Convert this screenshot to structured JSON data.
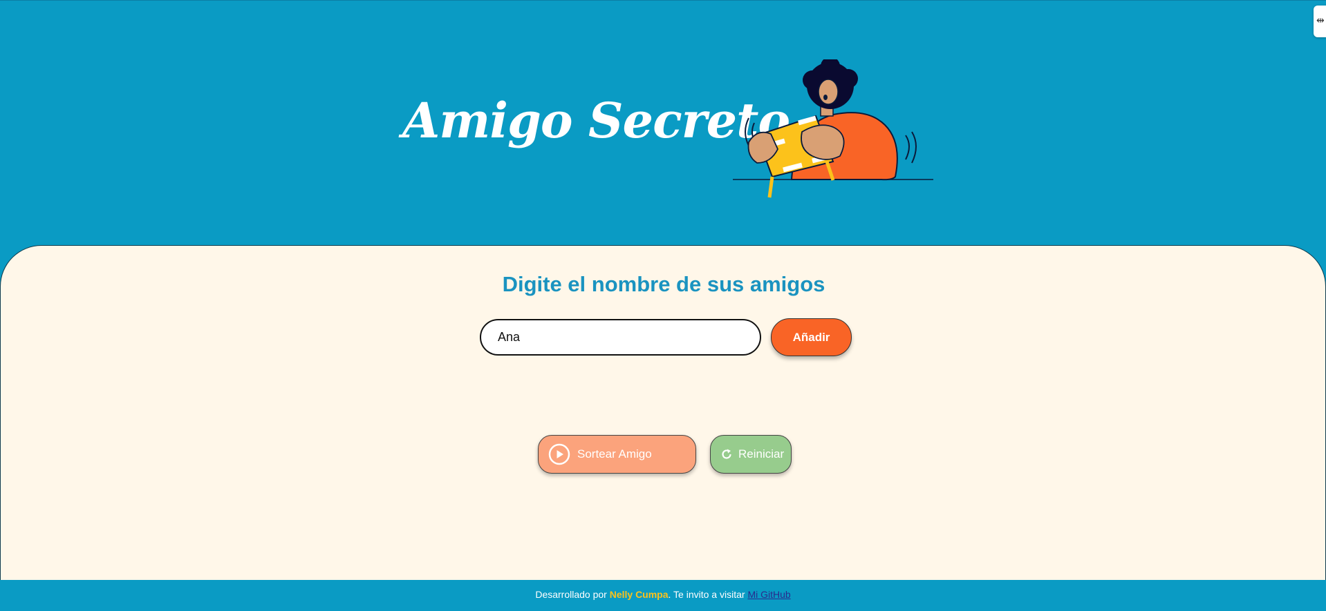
{
  "header": {
    "title": "Amigo Secreto"
  },
  "main": {
    "subtitle": "Digite el nombre de sus amigos",
    "input": {
      "value": "Ana",
      "placeholder": ""
    },
    "add_button": "Añadir",
    "draw_button": "Sortear Amigo",
    "reset_button": "Reiniciar"
  },
  "footer": {
    "prefix": "Desarrollado por ",
    "author": "Nelly Cumpa",
    "middle": ". Te invito a visitar ",
    "link": "Mi GitHub"
  },
  "colors": {
    "background": "#0a9bc4",
    "panel": "#fff7e9",
    "accent": "#f96426",
    "draw_button": "#fba37c",
    "reset_button": "#97cc8d",
    "author": "#fcc21b"
  },
  "icons": {
    "draw_button": "play-circle-icon",
    "reset_button": "refresh-icon",
    "corner_tab": "extension-tab-icon"
  }
}
